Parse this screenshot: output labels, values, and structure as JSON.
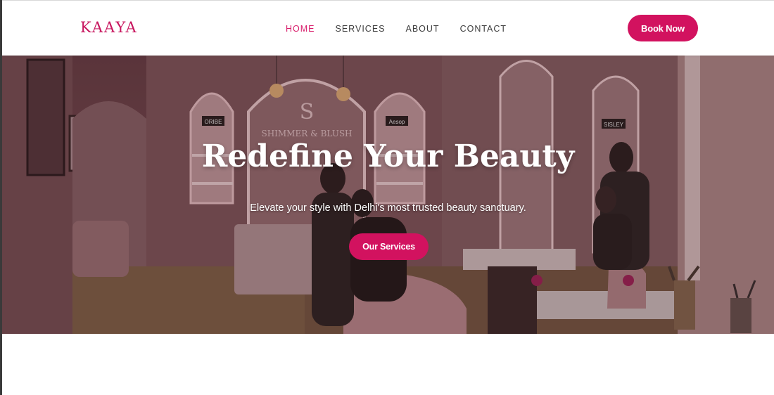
{
  "brand": {
    "logo": "KAAYA",
    "accent": "#d2125f"
  },
  "nav": {
    "items": [
      {
        "label": "HOME",
        "active": true
      },
      {
        "label": "SERVICES",
        "active": false
      },
      {
        "label": "ABOUT",
        "active": false
      },
      {
        "label": "CONTACT",
        "active": false
      }
    ],
    "cta_label": "Book Now"
  },
  "hero": {
    "title": "Redefine Your Beauty",
    "subtitle": "Elevate your style with Delhi's most trusted beauty sanctuary.",
    "cta_label": "Our Services",
    "background": {
      "signage": {
        "salon_name": "SHIMMER & BLUSH",
        "shelf_label_1": "ORIBE",
        "shelf_label_2": "Aesop",
        "shelf_label_3": "SISLEY"
      }
    }
  }
}
